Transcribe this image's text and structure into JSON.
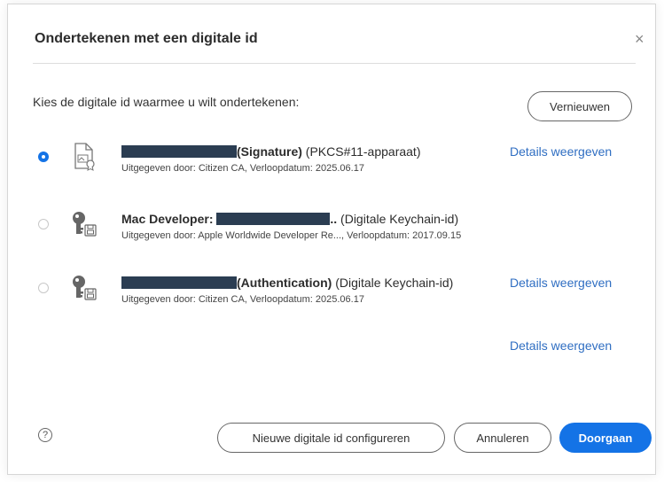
{
  "dialog": {
    "title": "Ondertekenen met een digitale id",
    "close_symbol": "×",
    "prompt": "Kies de digitale id waarmee u wilt ondertekenen:",
    "refresh_label": "Vernieuwen"
  },
  "ids": [
    {
      "selected": true,
      "icon": "certificate-file-icon",
      "name_bold": "(Signature)",
      "name_rest": " (PKCS#11-apparaat)",
      "issued": "Uitgegeven door: Citizen CA, Verloopdatum: 2025.06.17",
      "details": "Details weergeven"
    },
    {
      "selected": false,
      "icon": "key-icon",
      "name_prefix": "Mac Developer: ",
      "name_bold": "..",
      "name_rest": " (Digitale Keychain-id)",
      "issued": "Uitgegeven door: Apple Worldwide Developer Re..., Verloopdatum: 2017.09.15"
    },
    {
      "selected": false,
      "icon": "key-icon",
      "name_bold": "(Authentication)",
      "name_rest": " (Digitale Keychain-id)",
      "issued": "Uitgegeven door: Citizen CA, Verloopdatum: 2025.06.17",
      "details": "Details weergeven"
    }
  ],
  "extra_details": "Details weergeven",
  "footer": {
    "help_symbol": "?",
    "new_id_label": "Nieuwe digitale id configureren",
    "cancel_label": "Annuleren",
    "continue_label": "Doorgaan"
  },
  "colors": {
    "accent": "#1473e6",
    "link": "#2f6ec2",
    "redaction": "#2b3d52"
  }
}
